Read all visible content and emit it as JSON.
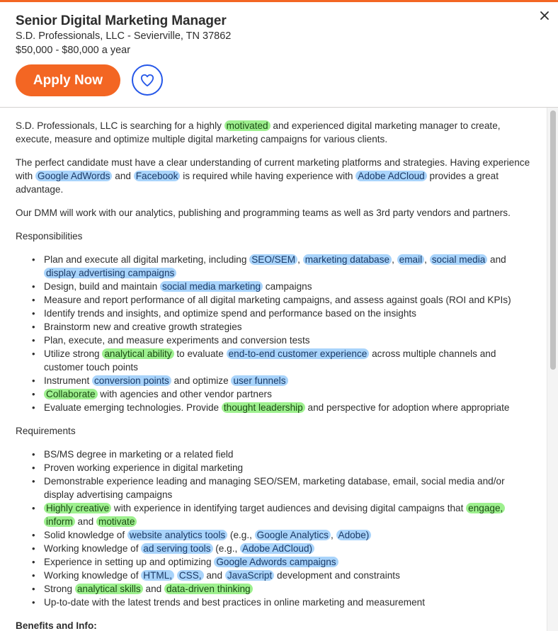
{
  "header": {
    "title": "Senior Digital Marketing Manager",
    "company_location": "S.D. Professionals, LLC - Sevierville, TN 37862",
    "salary": "$50,000 - $80,000 a year",
    "apply_label": "Apply Now",
    "save_icon": "heart-icon",
    "close_icon": "close-icon"
  },
  "colors": {
    "accent": "#f36623",
    "save_button": "#2557e8",
    "highlight_blue": "#a9d4fb",
    "highlight_green": "#9ef08f"
  },
  "description": {
    "p1": [
      {
        "t": "S.D. Professionals, LLC is searching for a highly "
      },
      {
        "t": "motivated",
        "h": "g"
      },
      {
        "t": " and experienced digital marketing manager to create, execute, measure and optimize multiple digital marketing campaigns for various clients."
      }
    ],
    "p2": [
      {
        "t": "The perfect candidate must have a clear understanding of current marketing platforms and strategies. Having experience with "
      },
      {
        "t": "Google AdWords",
        "h": "b"
      },
      {
        "t": " and "
      },
      {
        "t": "Facebook",
        "h": "b"
      },
      {
        "t": " is required while having experience with "
      },
      {
        "t": "Adobe AdCloud",
        "h": "b"
      },
      {
        "t": " provides a great advantage."
      }
    ],
    "p3": [
      {
        "t": "Our DMM will work with our analytics, publishing and programming teams as well as 3rd party vendors and partners."
      }
    ],
    "responsibilities_label": "Responsibilities",
    "responsibilities": [
      [
        {
          "t": "Plan and execute all digital marketing, including "
        },
        {
          "t": "SEO/SEM",
          "h": "b"
        },
        {
          "t": ", "
        },
        {
          "t": "marketing database",
          "h": "b"
        },
        {
          "t": ", "
        },
        {
          "t": "email",
          "h": "b"
        },
        {
          "t": ", "
        },
        {
          "t": "social media",
          "h": "b"
        },
        {
          "t": " and "
        },
        {
          "t": "display advertising campaigns",
          "h": "b"
        }
      ],
      [
        {
          "t": "Design, build and maintain "
        },
        {
          "t": "social media marketing",
          "h": "b"
        },
        {
          "t": " campaigns"
        }
      ],
      [
        {
          "t": "Measure and report performance of all digital marketing campaigns, and assess against goals (ROI and KPIs)"
        }
      ],
      [
        {
          "t": "Identify trends and insights, and optimize spend and performance based on the insights"
        }
      ],
      [
        {
          "t": "Brainstorm new and creative growth strategies"
        }
      ],
      [
        {
          "t": "Plan, execute, and measure experiments and conversion tests"
        }
      ],
      [
        {
          "t": "Utilize strong "
        },
        {
          "t": "analytical ability",
          "h": "g"
        },
        {
          "t": " to evaluate "
        },
        {
          "t": "end-to-end customer experience",
          "h": "b"
        },
        {
          "t": " across multiple channels and customer touch points"
        }
      ],
      [
        {
          "t": "Instrument "
        },
        {
          "t": "conversion points",
          "h": "b"
        },
        {
          "t": " and optimize "
        },
        {
          "t": "user funnels",
          "h": "b"
        }
      ],
      [
        {
          "t": "Collaborate",
          "h": "g"
        },
        {
          "t": " with agencies and other vendor partners"
        }
      ],
      [
        {
          "t": "Evaluate emerging technologies. Provide "
        },
        {
          "t": "thought leadership",
          "h": "g"
        },
        {
          "t": " and perspective for adoption where appropriate"
        }
      ]
    ],
    "requirements_label": "Requirements",
    "requirements": [
      [
        {
          "t": "BS/MS degree in marketing or a related field"
        }
      ],
      [
        {
          "t": "Proven working experience in digital marketing"
        }
      ],
      [
        {
          "t": "Demonstrable experience leading and managing SEO/SEM, marketing database, email, social media and/or display advertising campaigns"
        }
      ],
      [
        {
          "t": "Highly creative",
          "h": "g"
        },
        {
          "t": " with experience in identifying target audiences and devising digital campaigns that "
        },
        {
          "t": "engage,",
          "h": "g"
        },
        {
          "t": " "
        },
        {
          "t": "inform",
          "h": "g"
        },
        {
          "t": " and "
        },
        {
          "t": "motivate",
          "h": "g"
        }
      ],
      [
        {
          "t": "Solid knowledge of "
        },
        {
          "t": "website analytics tools",
          "h": "b"
        },
        {
          "t": " (e.g., "
        },
        {
          "t": "Google Analytics",
          "h": "b"
        },
        {
          "t": ", "
        },
        {
          "t": "Adobe)",
          "h": "b"
        }
      ],
      [
        {
          "t": "Working knowledge of "
        },
        {
          "t": "ad serving tools",
          "h": "b"
        },
        {
          "t": " (e.g., "
        },
        {
          "t": "Adobe AdCloud)",
          "h": "b"
        }
      ],
      [
        {
          "t": "Experience in setting up and optimizing "
        },
        {
          "t": "Google Adwords campaigns",
          "h": "b"
        }
      ],
      [
        {
          "t": "Working knowledge of "
        },
        {
          "t": "HTML,",
          "h": "b"
        },
        {
          "t": " "
        },
        {
          "t": "CSS,",
          "h": "b"
        },
        {
          "t": " and "
        },
        {
          "t": "JavaScript",
          "h": "b"
        },
        {
          "t": " development and constraints"
        }
      ],
      [
        {
          "t": "Strong "
        },
        {
          "t": "analytical skills",
          "h": "g"
        },
        {
          "t": " and "
        },
        {
          "t": "data-driven thinking",
          "h": "g"
        }
      ],
      [
        {
          "t": "Up-to-date with the latest trends and best practices in online marketing and measurement"
        }
      ]
    ],
    "benefits_label": "Benefits and Info:"
  }
}
